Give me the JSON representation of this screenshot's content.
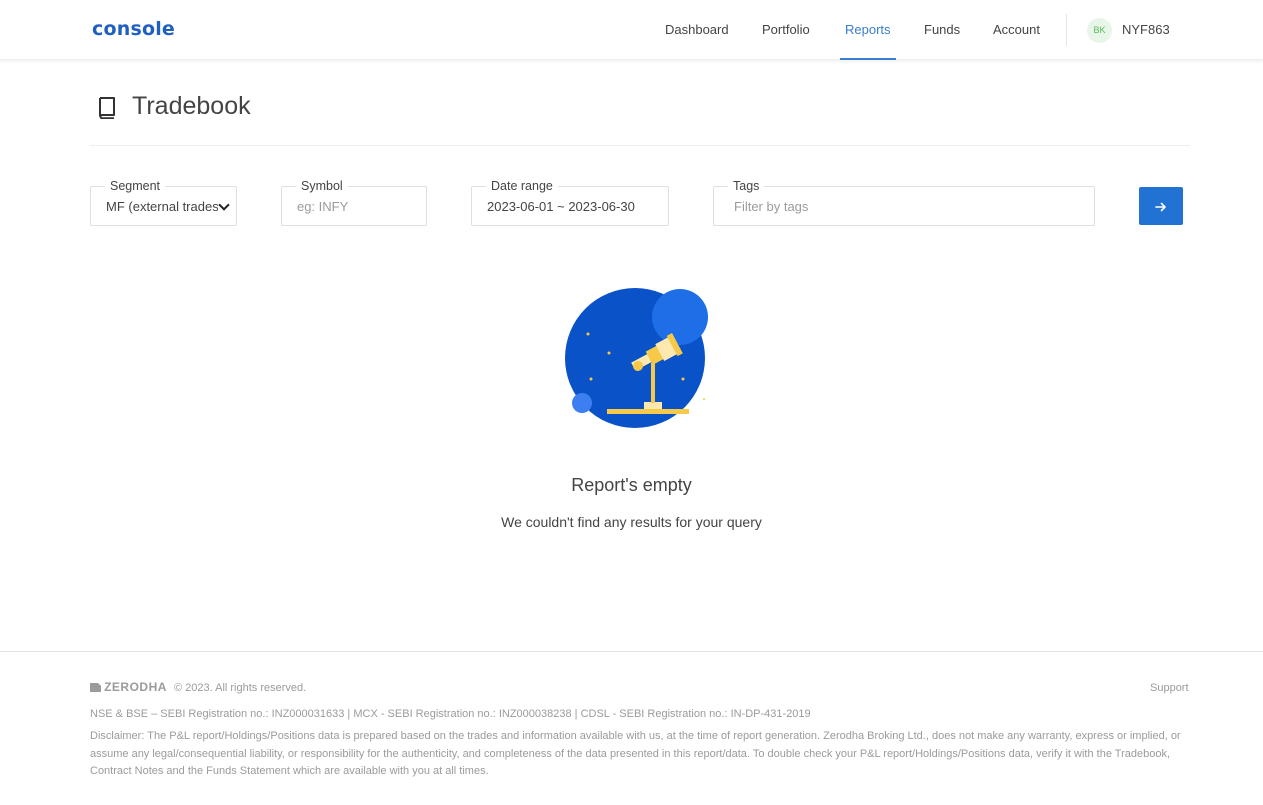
{
  "header": {
    "logo": "console",
    "nav": [
      {
        "label": "Dashboard"
      },
      {
        "label": "Portfolio"
      },
      {
        "label": "Reports",
        "active": true
      },
      {
        "label": "Funds"
      },
      {
        "label": "Account"
      }
    ],
    "avatar_initials": "BK",
    "user_id": "NYF863"
  },
  "page": {
    "title": "Tradebook",
    "icon": "book-icon"
  },
  "filters": {
    "segment": {
      "label": "Segment",
      "value": "MF (external trades)"
    },
    "symbol": {
      "label": "Symbol",
      "placeholder": "eg: INFY"
    },
    "date_range": {
      "label": "Date range",
      "value": "2023-06-01 ~ 2023-06-30"
    },
    "tags": {
      "label": "Tags",
      "placeholder": "Filter by tags"
    },
    "submit_icon": "arrow-right-icon"
  },
  "empty_state": {
    "icon": "telescope-illustration",
    "title": "Report's empty",
    "message": "We couldn't find any results for your query"
  },
  "footer": {
    "brand": "ZERODHA",
    "copyright": "© 2023. All rights reserved.",
    "support": "Support",
    "registration": "NSE & BSE – SEBI Registration no.: INZ000031633 | MCX - SEBI Registration no.: INZ000038238 | CDSL - SEBI Registration no.: IN-DP-431-2019",
    "disclaimer": "Disclaimer: The P&L report/Holdings/Positions data is prepared based on the trades and information available with us, at the time of report generation. Zerodha Broking Ltd., does not make any warranty, express or implied, or assume any legal/consequential liability, or responsibility for the authenticity, and completeness of the data presented in this report/data. To double check your P&L report/Holdings/Positions data, verify it with the Tradebook, Contract Notes and the Funds Statement which are available with you at all times."
  },
  "colors": {
    "accent": "#387ed1",
    "button": "#2272d4",
    "illustration_blue": "#0a52c7",
    "illustration_yellow": "#f7c948"
  }
}
